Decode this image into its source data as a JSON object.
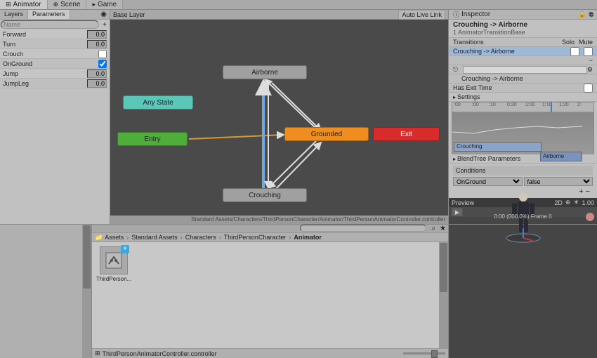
{
  "tabs": {
    "animator": "Animator",
    "scene": "Scene",
    "game": "Game"
  },
  "params_header": {
    "layers": "Layers",
    "parameters": "Parameters",
    "search_placeholder": "Name"
  },
  "parameters": [
    {
      "name": "Forward",
      "value": "0.0",
      "type": "float"
    },
    {
      "name": "Turn",
      "value": "0.0",
      "type": "float"
    },
    {
      "name": "Crouch",
      "value": "",
      "type": "bool",
      "checked": false
    },
    {
      "name": "OnGround",
      "value": "",
      "type": "bool",
      "checked": true
    },
    {
      "name": "Jump",
      "value": "0.0",
      "type": "float"
    },
    {
      "name": "JumpLeg",
      "value": "0.0",
      "type": "float"
    }
  ],
  "graph": {
    "base_layer": "Base Layer",
    "auto_live_link": "Auto Live Link",
    "states": {
      "any": "Any State",
      "entry": "Entry",
      "grounded": "Grounded",
      "airborne": "Airborne",
      "crouching": "Crouching",
      "exit": "Exit"
    },
    "footer": "Standard Assets/Characters/ThirdPersonCharacter/Animator/ThirdPersonAnimatorController.controller"
  },
  "inspector": {
    "tab": "Inspector",
    "title": "Crouching -> Airborne",
    "subtitle": "1 AnimatorTransitionBase",
    "transitions_label": "Transitions",
    "solo": "Solo",
    "mute": "Mute",
    "transition_item": "Crouching -> Airborne",
    "name_value": "Crouching -> Airborne",
    "has_exit_time": "Has Exit Time",
    "settings": "Settings",
    "timeline_ticks": [
      ":00",
      ":00",
      ":10",
      "0:20",
      "1:00",
      "1:10",
      "1:20",
      "2:"
    ],
    "timeline_clips": {
      "c1": "Crouching",
      "c2": "Airborne"
    },
    "blendtree": "BlendTree Parameters",
    "conditions_label": "Conditions",
    "condition_param": "OnGround",
    "condition_value": "false",
    "preview": "Preview",
    "preview_2d": "2D",
    "preview_speed": "1.00",
    "preview_frame": "0:00 (000.0%) Frame 0"
  },
  "project": {
    "breadcrumb": [
      "Assets",
      "Standard Assets",
      "Characters",
      "ThirdPersonCharacter",
      "Animator"
    ],
    "asset_name": "ThirdPerson...",
    "footer_file": "ThirdPersonAnimatorController.controller"
  }
}
